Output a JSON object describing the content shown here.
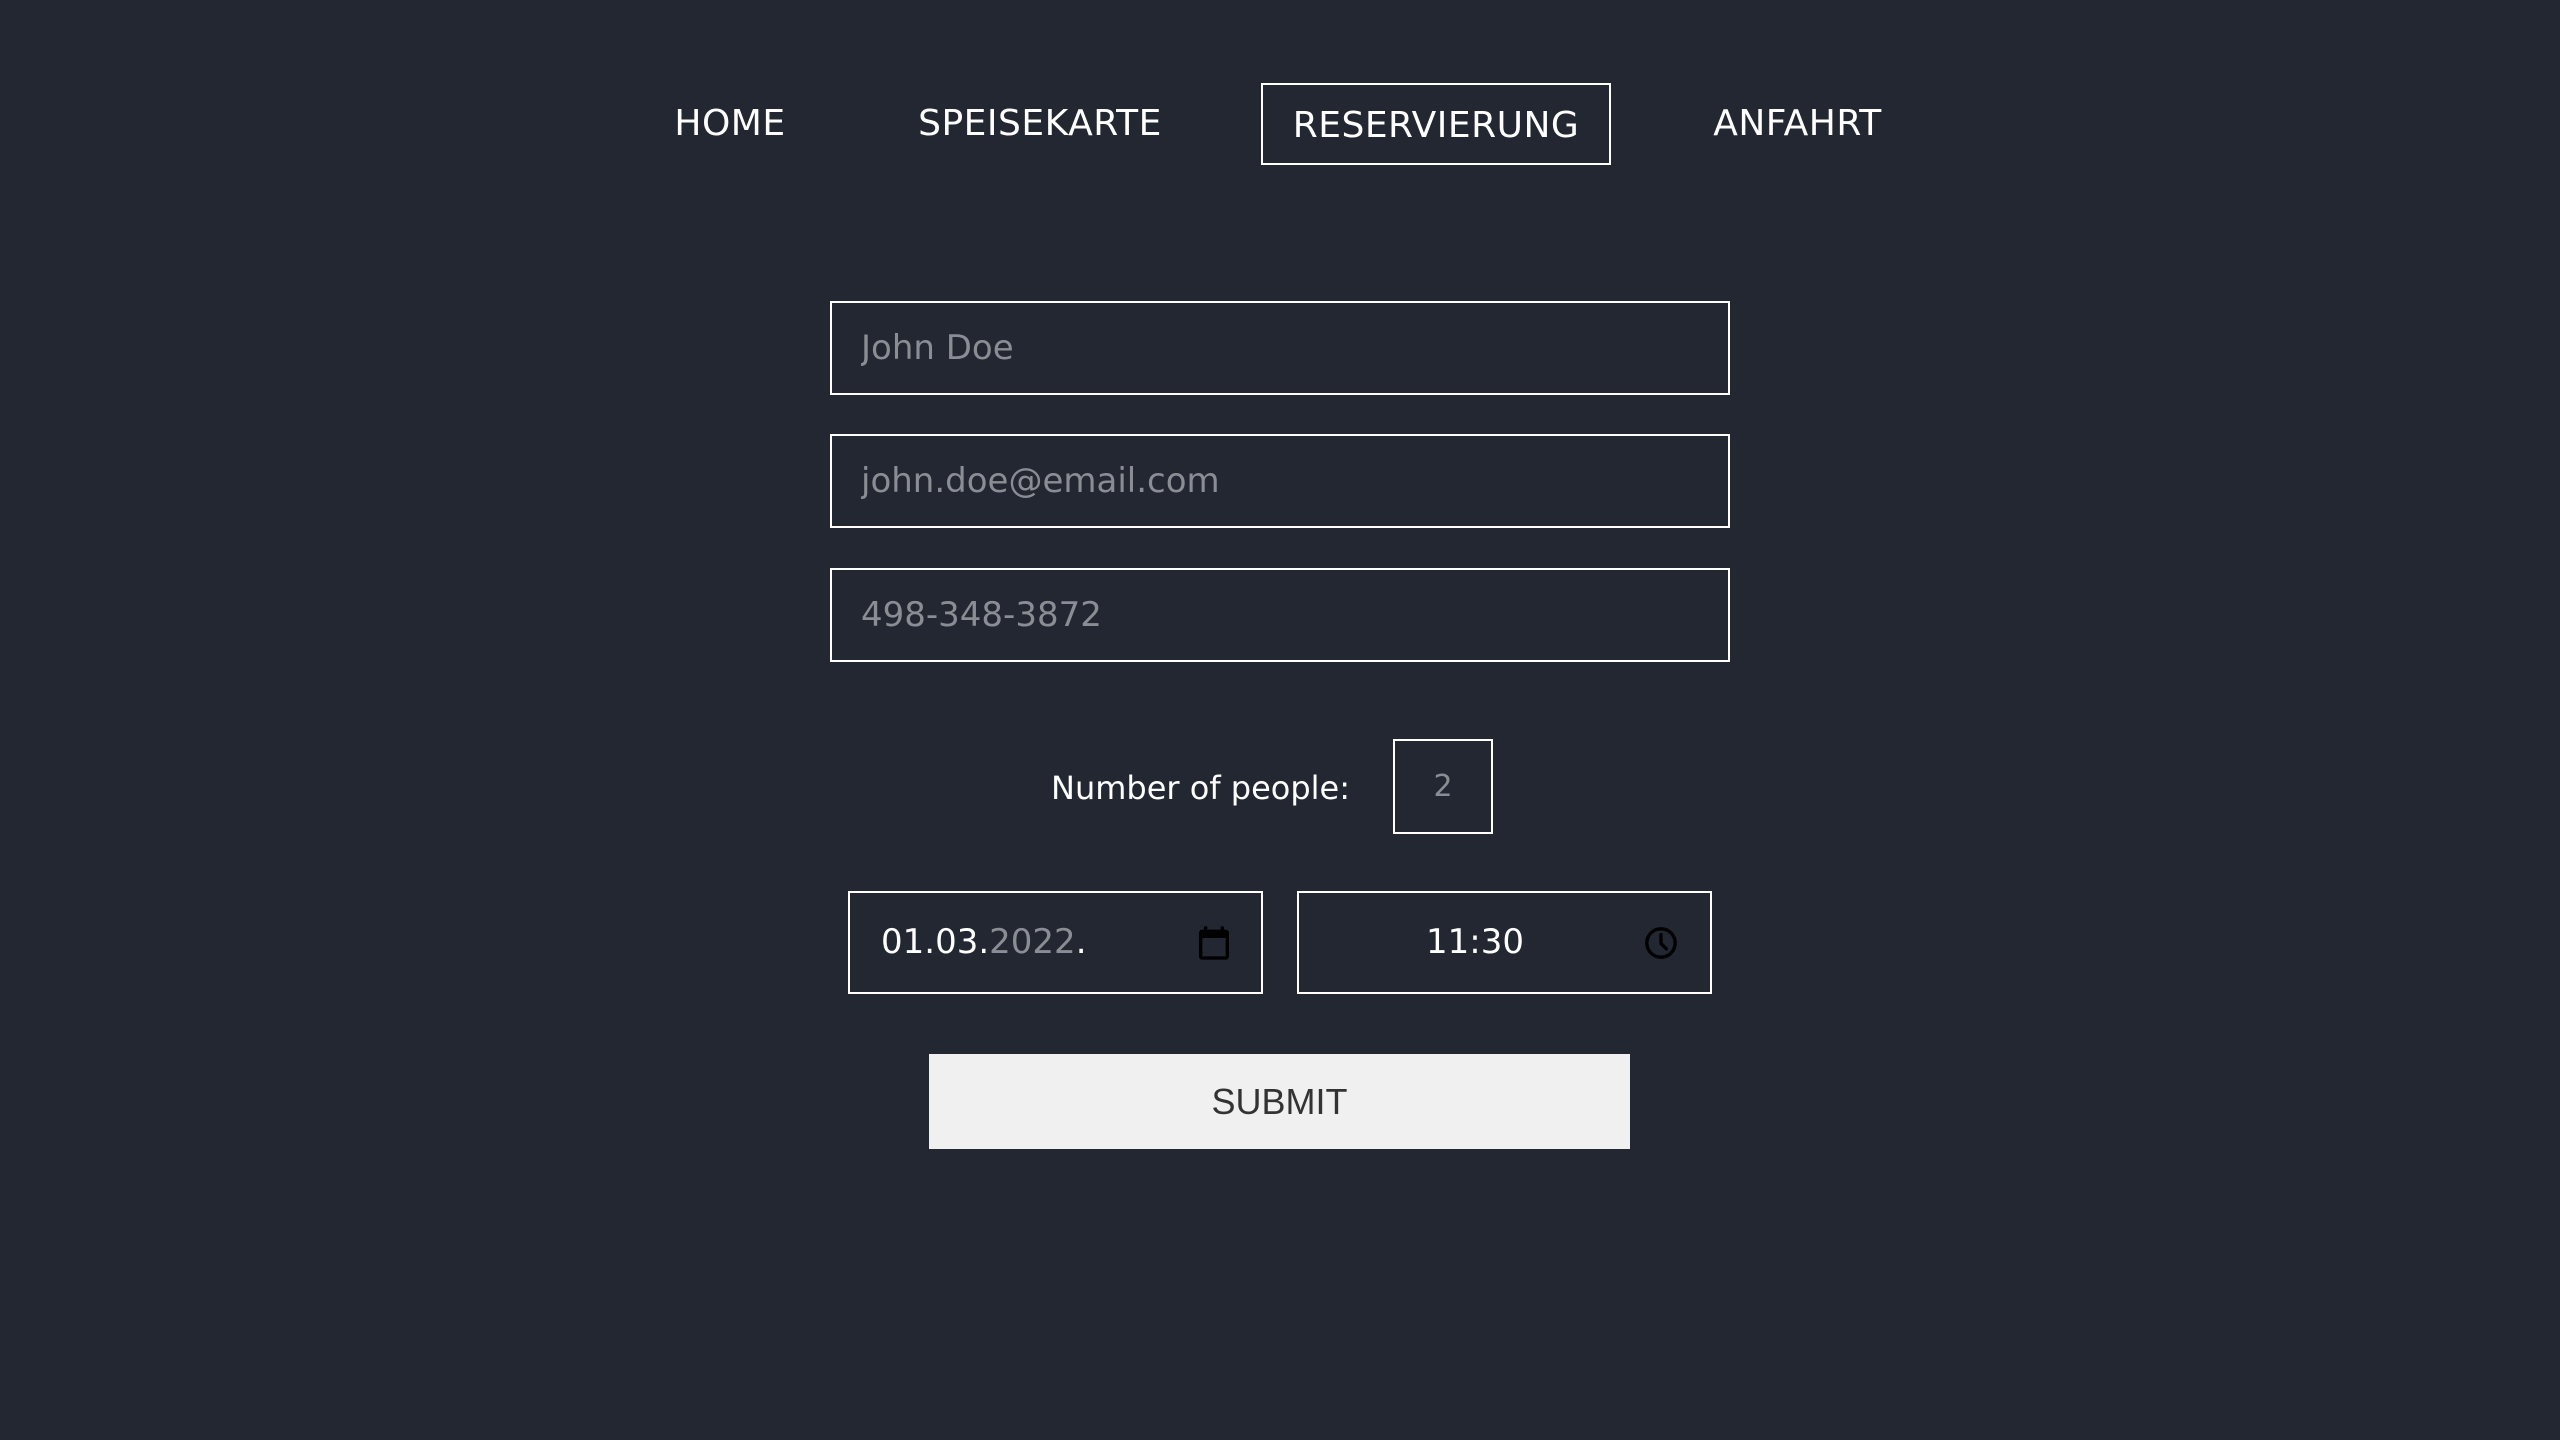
{
  "nav": {
    "items": [
      {
        "label": "HOME"
      },
      {
        "label": "SPEISEKARTE"
      },
      {
        "label": "RESERVIERUNG",
        "active": true
      },
      {
        "label": "ANFAHRT"
      }
    ]
  },
  "form": {
    "name": {
      "placeholder": "John Doe",
      "value": ""
    },
    "email": {
      "placeholder": "john.doe@email.com",
      "value": ""
    },
    "phone": {
      "placeholder": "498-348-3872",
      "value": ""
    },
    "people": {
      "label": "Number of people:",
      "placeholder": "2"
    },
    "date": {
      "day_month": "01.03.",
      "year": "2022",
      "trailing": ".",
      "icon": "calendar-icon"
    },
    "time": {
      "value": "11:30",
      "icon": "clock-icon"
    },
    "submit_label": "SUBMIT"
  },
  "colors": {
    "background": "#222731",
    "foreground": "#ffffff",
    "placeholder": "#8a8d93",
    "button_bg": "#f0f0f0",
    "button_text": "#333333"
  }
}
